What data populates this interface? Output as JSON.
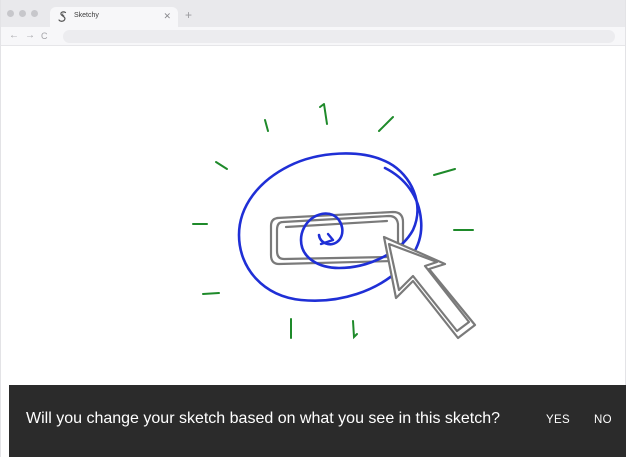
{
  "browser": {
    "tab": {
      "title": "Sketchy",
      "close_icon": "close-icon",
      "favicon": "sketchy-logo-icon"
    },
    "new_tab_glyph": "+",
    "nav": {
      "back_glyph": "←",
      "forward_glyph": "→",
      "reload_glyph": "C"
    }
  },
  "sketch": {
    "description_icon": "button-click-sketch",
    "colors": {
      "rays": "#1e8a2a",
      "spiral": "#1f2fd6",
      "button": "#7a7a7a",
      "cursor": "#7a7a7a"
    }
  },
  "prompt_bar": {
    "question": "Will you change your sketch based on what you see in this sketch?",
    "yes_label": "YES",
    "no_label": "NO"
  }
}
